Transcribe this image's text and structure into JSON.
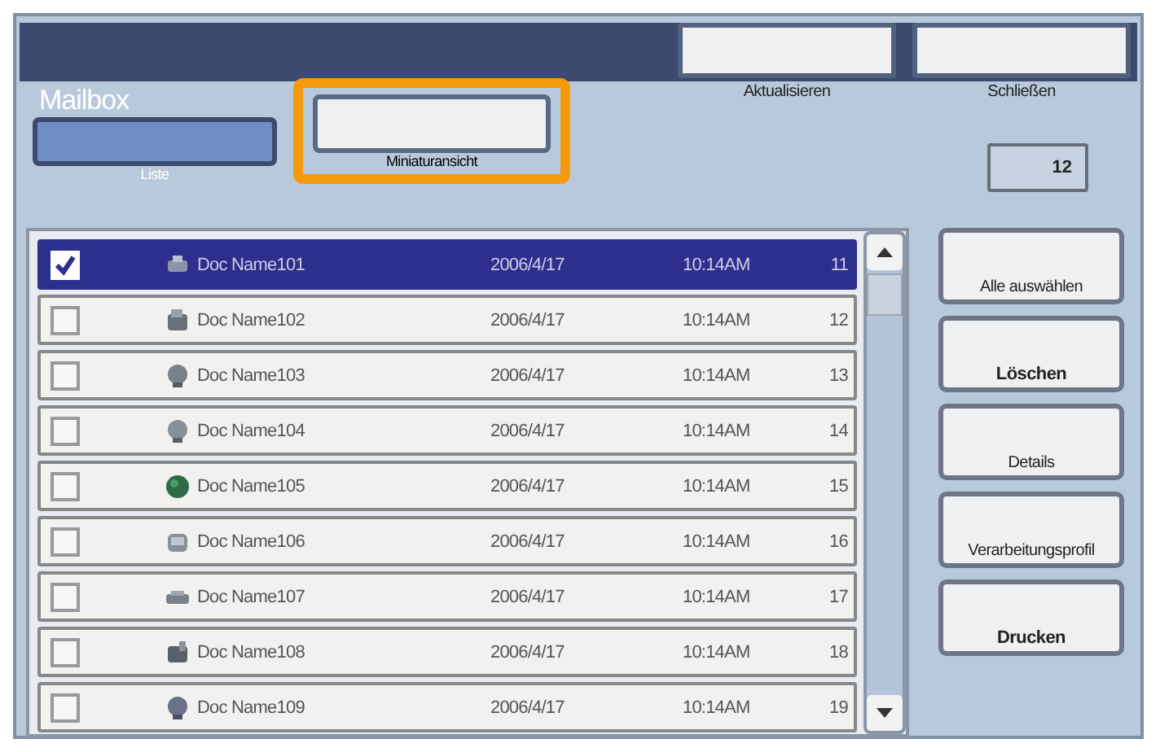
{
  "window": {
    "title": "Mailbox"
  },
  "top_buttons": [
    {
      "label": "Aktualisieren"
    },
    {
      "label": "Schließen"
    }
  ],
  "view_buttons": [
    {
      "label": "Liste",
      "selected": true
    },
    {
      "label": "Miniaturansicht",
      "selected": false
    }
  ],
  "count": "12",
  "rows": [
    {
      "name": "Doc Name101",
      "date": "2006/4/17",
      "time": "10:14AM",
      "number": "11",
      "checked": true,
      "selected": true
    },
    {
      "name": "Doc Name102",
      "date": "2006/4/17",
      "time": "10:14AM",
      "number": "12",
      "checked": false,
      "selected": false
    },
    {
      "name": "Doc Name103",
      "date": "2006/4/17",
      "time": "10:14AM",
      "number": "13",
      "checked": false,
      "selected": false
    },
    {
      "name": "Doc Name104",
      "date": "2006/4/17",
      "time": "10:14AM",
      "number": "14",
      "checked": false,
      "selected": false
    },
    {
      "name": "Doc Name105",
      "date": "2006/4/17",
      "time": "10:14AM",
      "number": "15",
      "checked": false,
      "selected": false
    },
    {
      "name": "Doc Name106",
      "date": "2006/4/17",
      "time": "10:14AM",
      "number": "16",
      "checked": false,
      "selected": false
    },
    {
      "name": "Doc Name107",
      "date": "2006/4/17",
      "time": "10:14AM",
      "number": "17",
      "checked": false,
      "selected": false
    },
    {
      "name": "Doc Name108",
      "date": "2006/4/17",
      "time": "10:14AM",
      "number": "18",
      "checked": false,
      "selected": false
    },
    {
      "name": "Doc Name109",
      "date": "2006/4/17",
      "time": "10:14AM",
      "number": "19",
      "checked": false,
      "selected": false
    }
  ],
  "side_buttons": [
    {
      "label": "Alle auswählen"
    },
    {
      "label": "Löschen"
    },
    {
      "label": "Details"
    },
    {
      "label": "Verarbeitungsprofil"
    },
    {
      "label": "Drucken"
    }
  ]
}
